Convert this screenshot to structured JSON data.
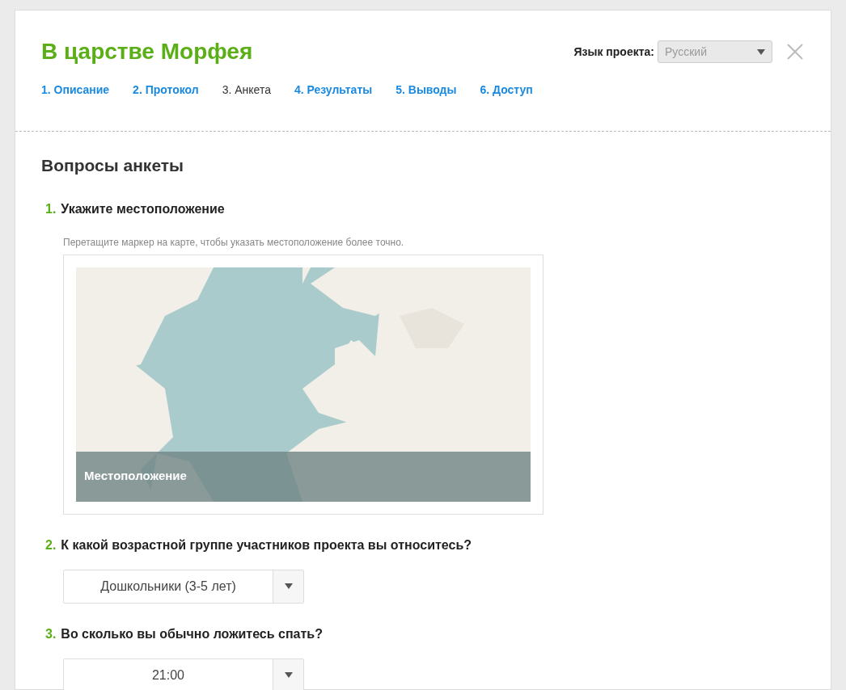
{
  "project_title": "В царстве Морфея",
  "language": {
    "label": "Язык проекта:",
    "value": "Русский"
  },
  "tabs": [
    {
      "label": "1. Описание",
      "selected": false
    },
    {
      "label": "2. Протокол",
      "selected": false
    },
    {
      "label": "3. Анкета",
      "selected": true
    },
    {
      "label": "4. Результаты",
      "selected": false
    },
    {
      "label": "5. Выводы",
      "selected": false
    },
    {
      "label": "6. Доступ",
      "selected": false
    }
  ],
  "section_title": "Вопросы анкеты",
  "questions": [
    {
      "kind": "map",
      "number": "1.",
      "text": "Укажите местоположение",
      "hint": "Перетащите маркер на карте, чтобы указать местоположение более точно.",
      "map_caption": "Местоположение"
    },
    {
      "kind": "select",
      "number": "2.",
      "text": "К какой возрастной группе участников проекта вы относитесь?",
      "value": "Дошкольники (3-5 лет)"
    },
    {
      "kind": "select",
      "number": "3.",
      "text": "Во сколько вы обычно ложитесь спать?",
      "value": "21:00"
    }
  ]
}
